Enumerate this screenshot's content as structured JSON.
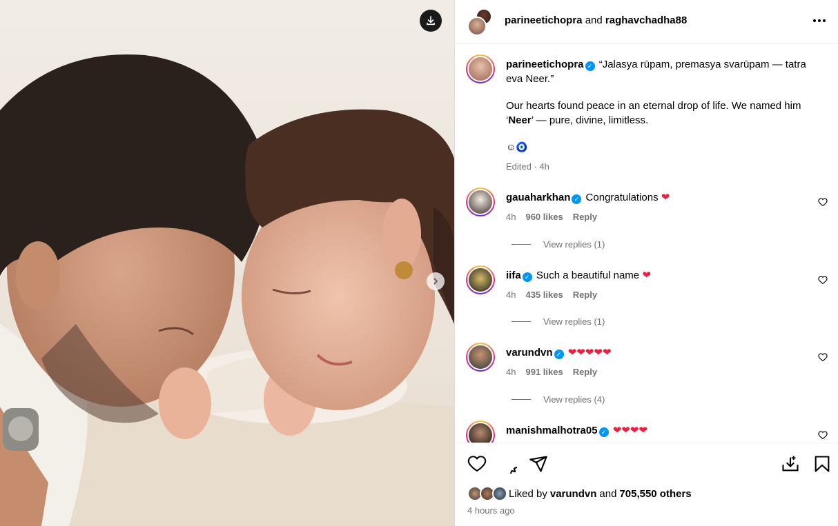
{
  "header": {
    "user1": "parineetichopra",
    "joiner": "and",
    "user2": "raghavchadha88"
  },
  "caption": {
    "username": "parineetichopra",
    "line1": "“Jalasya rūpam, premasya svarūpam — tatra eva Neer.”",
    "para_before": "Our hearts found peace in an eternal drop of life. We named him ‘",
    "para_bold": "Neer",
    "para_after": "’ — pure, divine, limitless.",
    "emojis": "☺🧿",
    "edited": "Edited",
    "time": "4h"
  },
  "comments": [
    {
      "username": "gauaharkhan",
      "text": "Congratulations",
      "hearts": "❤",
      "time": "4h",
      "likes": "960 likes",
      "reply": "Reply",
      "view_replies": "View replies (1)"
    },
    {
      "username": "iifa",
      "text": "Such a beautiful name",
      "hearts": "❤",
      "time": "4h",
      "likes": "435 likes",
      "reply": "Reply",
      "view_replies": "View replies (1)"
    },
    {
      "username": "varundvn",
      "text": "",
      "hearts": "❤❤❤❤❤",
      "time": "4h",
      "likes": "991 likes",
      "reply": "Reply",
      "view_replies": "View replies (4)"
    },
    {
      "username": "manishmalhotra05",
      "text": "",
      "hearts": "❤❤❤❤"
    }
  ],
  "footer": {
    "liked_by": "Liked by",
    "liked_user": "varundvn",
    "and": "and",
    "others": "705,550 others",
    "posted": "4 hours ago"
  },
  "icons": {
    "download": "download-icon",
    "next": "chevron-right-icon",
    "more": "more-icon",
    "like": "heart-icon",
    "comment": "comment-icon",
    "share": "share-icon",
    "save_download": "download-icon",
    "save": "bookmark-icon"
  },
  "colors": {
    "verified": "#0095f6",
    "heart": "#ed1f3e",
    "muted": "#737373"
  }
}
